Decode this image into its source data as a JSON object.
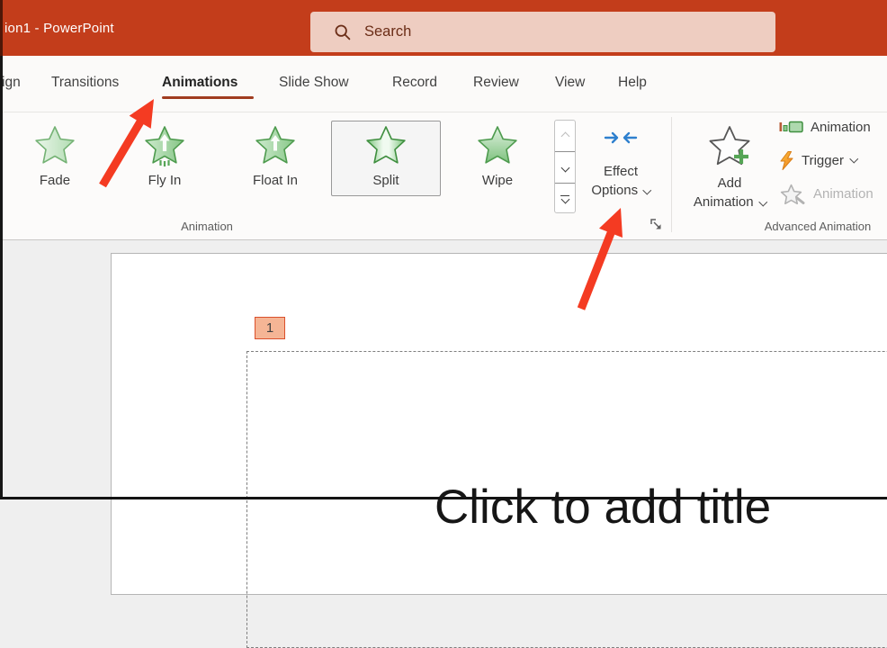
{
  "colors": {
    "titlebar": "#c33d1b",
    "accent_underline": "#a03c20",
    "arrow_red": "#f43b22",
    "search_pill": "#eecdc1",
    "search_text": "#6b2d17",
    "badge_fill": "#f5b595",
    "badge_border": "#da502c",
    "star_green": "#4e9b4e",
    "effect_icon_blue": "#2e80ce",
    "trigger_orange": "#ef7d1f"
  },
  "titlebar": {
    "title": "ion1  -  PowerPoint",
    "search_label": "Search"
  },
  "tabs": {
    "items": [
      {
        "label": "ign"
      },
      {
        "label": "Transitions"
      },
      {
        "label": "Animations"
      },
      {
        "label": "Slide Show"
      },
      {
        "label": "Record"
      },
      {
        "label": "Review"
      },
      {
        "label": "View"
      },
      {
        "label": "Help"
      }
    ],
    "active": "Animations"
  },
  "ribbon": {
    "gallery": {
      "items": [
        {
          "label": "Fade"
        },
        {
          "label": "Fly In"
        },
        {
          "label": "Float In"
        },
        {
          "label": "Split"
        },
        {
          "label": "Wipe"
        }
      ],
      "selected": "Split"
    },
    "effect_options": {
      "line1": "Effect",
      "line2": "Options"
    },
    "group_animation": "Animation",
    "add_animation": {
      "line1": "Add",
      "line2": "Animation"
    },
    "animation_pane_label": "Animation",
    "trigger_label": "Trigger",
    "animation_painter_label": "Animation",
    "group_advanced": "Advanced Animation"
  },
  "slide": {
    "number": "1",
    "title_placeholder": "Click to add title"
  }
}
